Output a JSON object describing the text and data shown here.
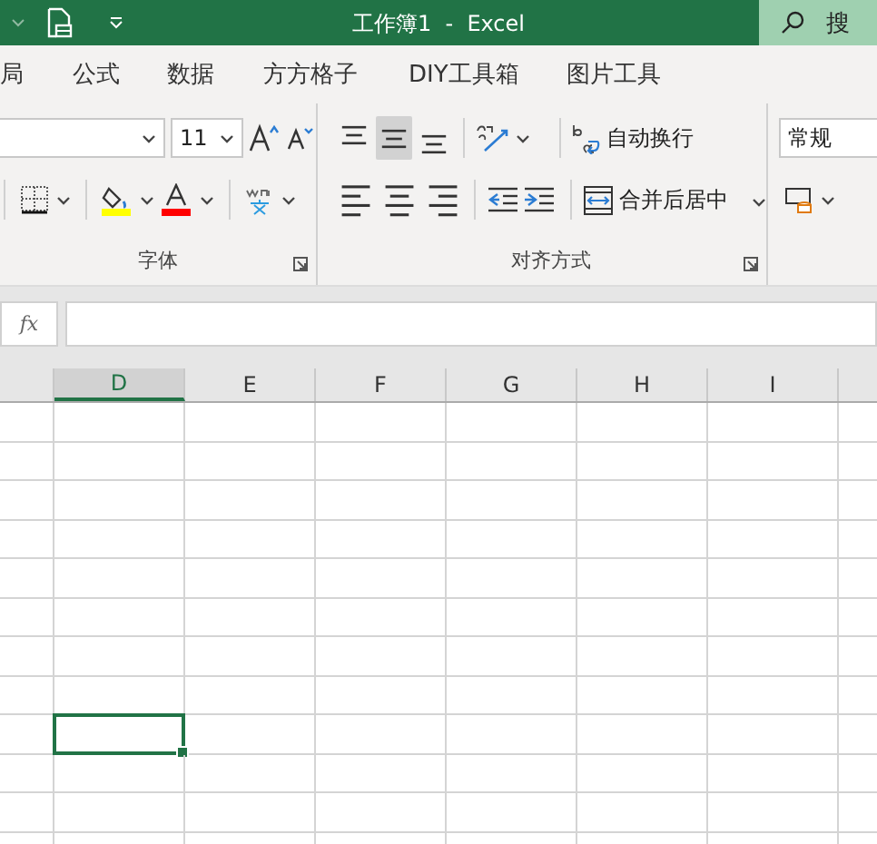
{
  "title_bar": {
    "title": "工作簿1  -  Excel",
    "search": {
      "placeholder": "搜"
    }
  },
  "ribbon_tabs": [
    {
      "label": "局",
      "selected": false
    },
    {
      "label": "公式",
      "selected": false
    },
    {
      "label": "数据",
      "selected": false
    },
    {
      "label": "方方格子",
      "selected": false
    },
    {
      "label": "DIY工具箱",
      "selected": false
    },
    {
      "label": "图片工具",
      "selected": false
    }
  ],
  "font_group": {
    "font_size": "11",
    "label": "字体"
  },
  "alignment_group": {
    "label": "对齐方式",
    "wrap_text": "自动换行",
    "merge_center": "合并后居中",
    "vertical_align": [
      {
        "kind": "top",
        "selected": false
      },
      {
        "kind": "middle",
        "selected": true
      },
      {
        "kind": "bottom",
        "selected": false
      }
    ]
  },
  "number_group": {
    "format": "常规"
  },
  "formula_bar": {
    "fx": "fx"
  },
  "columns": [
    {
      "label": "D",
      "selected": true
    },
    {
      "label": "E",
      "selected": false
    },
    {
      "label": "F",
      "selected": false
    },
    {
      "label": "G",
      "selected": false
    },
    {
      "label": "H",
      "selected": false
    },
    {
      "label": "I",
      "selected": false
    }
  ],
  "rows": [
    {
      "selected": false
    },
    {
      "selected": false
    },
    {
      "selected": false
    },
    {
      "selected": false
    },
    {
      "selected": false
    },
    {
      "selected": false
    },
    {
      "selected": false
    },
    {
      "selected": false
    },
    {
      "selected": true
    },
    {
      "selected": false
    },
    {
      "selected": false
    },
    {
      "selected": false
    }
  ]
}
